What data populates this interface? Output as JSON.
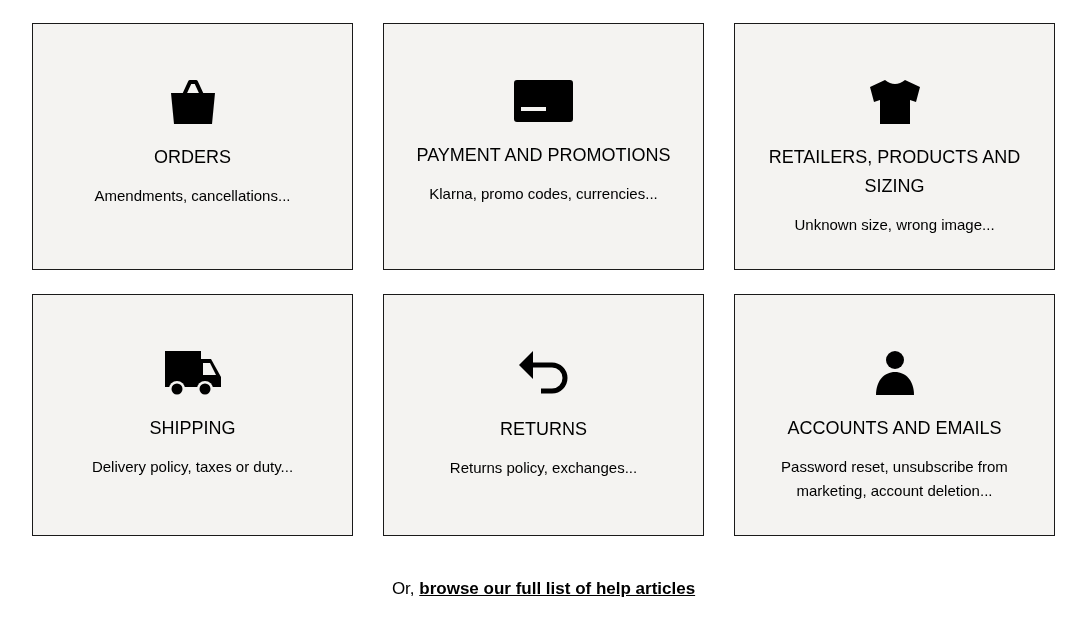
{
  "topics": [
    {
      "kind": "orders",
      "title": "ORDERS",
      "description": "Amendments, cancellations..."
    },
    {
      "kind": "payment",
      "title": "PAYMENT AND PROMOTIONS",
      "description": "Klarna, promo codes, currencies..."
    },
    {
      "kind": "products",
      "title": "RETAILERS, PRODUCTS AND SIZING",
      "description": "Unknown size, wrong image..."
    },
    {
      "kind": "shipping",
      "title": "SHIPPING",
      "description": "Delivery policy, taxes or duty..."
    },
    {
      "kind": "returns",
      "title": "RETURNS",
      "description": "Returns policy, exchanges..."
    },
    {
      "kind": "accounts",
      "title": "ACCOUNTS AND EMAILS",
      "description": "Password reset, unsubscribe from marketing, account deletion..."
    }
  ],
  "footer": {
    "prefix": "Or,",
    "link": "browse our full list of help articles"
  }
}
